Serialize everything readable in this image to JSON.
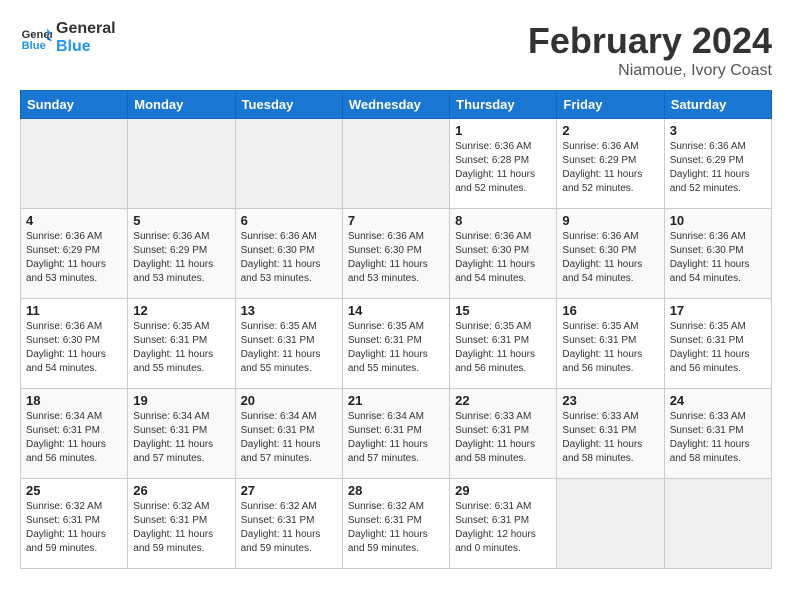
{
  "header": {
    "logo_line1": "General",
    "logo_line2": "Blue",
    "month": "February 2024",
    "location": "Niamoue, Ivory Coast"
  },
  "weekdays": [
    "Sunday",
    "Monday",
    "Tuesday",
    "Wednesday",
    "Thursday",
    "Friday",
    "Saturday"
  ],
  "weeks": [
    [
      {
        "day": "",
        "info": ""
      },
      {
        "day": "",
        "info": ""
      },
      {
        "day": "",
        "info": ""
      },
      {
        "day": "",
        "info": ""
      },
      {
        "day": "1",
        "info": "Sunrise: 6:36 AM\nSunset: 6:28 PM\nDaylight: 11 hours\nand 52 minutes."
      },
      {
        "day": "2",
        "info": "Sunrise: 6:36 AM\nSunset: 6:29 PM\nDaylight: 11 hours\nand 52 minutes."
      },
      {
        "day": "3",
        "info": "Sunrise: 6:36 AM\nSunset: 6:29 PM\nDaylight: 11 hours\nand 52 minutes."
      }
    ],
    [
      {
        "day": "4",
        "info": "Sunrise: 6:36 AM\nSunset: 6:29 PM\nDaylight: 11 hours\nand 53 minutes."
      },
      {
        "day": "5",
        "info": "Sunrise: 6:36 AM\nSunset: 6:29 PM\nDaylight: 11 hours\nand 53 minutes."
      },
      {
        "day": "6",
        "info": "Sunrise: 6:36 AM\nSunset: 6:30 PM\nDaylight: 11 hours\nand 53 minutes."
      },
      {
        "day": "7",
        "info": "Sunrise: 6:36 AM\nSunset: 6:30 PM\nDaylight: 11 hours\nand 53 minutes."
      },
      {
        "day": "8",
        "info": "Sunrise: 6:36 AM\nSunset: 6:30 PM\nDaylight: 11 hours\nand 54 minutes."
      },
      {
        "day": "9",
        "info": "Sunrise: 6:36 AM\nSunset: 6:30 PM\nDaylight: 11 hours\nand 54 minutes."
      },
      {
        "day": "10",
        "info": "Sunrise: 6:36 AM\nSunset: 6:30 PM\nDaylight: 11 hours\nand 54 minutes."
      }
    ],
    [
      {
        "day": "11",
        "info": "Sunrise: 6:36 AM\nSunset: 6:30 PM\nDaylight: 11 hours\nand 54 minutes."
      },
      {
        "day": "12",
        "info": "Sunrise: 6:35 AM\nSunset: 6:31 PM\nDaylight: 11 hours\nand 55 minutes."
      },
      {
        "day": "13",
        "info": "Sunrise: 6:35 AM\nSunset: 6:31 PM\nDaylight: 11 hours\nand 55 minutes."
      },
      {
        "day": "14",
        "info": "Sunrise: 6:35 AM\nSunset: 6:31 PM\nDaylight: 11 hours\nand 55 minutes."
      },
      {
        "day": "15",
        "info": "Sunrise: 6:35 AM\nSunset: 6:31 PM\nDaylight: 11 hours\nand 56 minutes."
      },
      {
        "day": "16",
        "info": "Sunrise: 6:35 AM\nSunset: 6:31 PM\nDaylight: 11 hours\nand 56 minutes."
      },
      {
        "day": "17",
        "info": "Sunrise: 6:35 AM\nSunset: 6:31 PM\nDaylight: 11 hours\nand 56 minutes."
      }
    ],
    [
      {
        "day": "18",
        "info": "Sunrise: 6:34 AM\nSunset: 6:31 PM\nDaylight: 11 hours\nand 56 minutes."
      },
      {
        "day": "19",
        "info": "Sunrise: 6:34 AM\nSunset: 6:31 PM\nDaylight: 11 hours\nand 57 minutes."
      },
      {
        "day": "20",
        "info": "Sunrise: 6:34 AM\nSunset: 6:31 PM\nDaylight: 11 hours\nand 57 minutes."
      },
      {
        "day": "21",
        "info": "Sunrise: 6:34 AM\nSunset: 6:31 PM\nDaylight: 11 hours\nand 57 minutes."
      },
      {
        "day": "22",
        "info": "Sunrise: 6:33 AM\nSunset: 6:31 PM\nDaylight: 11 hours\nand 58 minutes."
      },
      {
        "day": "23",
        "info": "Sunrise: 6:33 AM\nSunset: 6:31 PM\nDaylight: 11 hours\nand 58 minutes."
      },
      {
        "day": "24",
        "info": "Sunrise: 6:33 AM\nSunset: 6:31 PM\nDaylight: 11 hours\nand 58 minutes."
      }
    ],
    [
      {
        "day": "25",
        "info": "Sunrise: 6:32 AM\nSunset: 6:31 PM\nDaylight: 11 hours\nand 59 minutes."
      },
      {
        "day": "26",
        "info": "Sunrise: 6:32 AM\nSunset: 6:31 PM\nDaylight: 11 hours\nand 59 minutes."
      },
      {
        "day": "27",
        "info": "Sunrise: 6:32 AM\nSunset: 6:31 PM\nDaylight: 11 hours\nand 59 minutes."
      },
      {
        "day": "28",
        "info": "Sunrise: 6:32 AM\nSunset: 6:31 PM\nDaylight: 11 hours\nand 59 minutes."
      },
      {
        "day": "29",
        "info": "Sunrise: 6:31 AM\nSunset: 6:31 PM\nDaylight: 12 hours\nand 0 minutes."
      },
      {
        "day": "",
        "info": ""
      },
      {
        "day": "",
        "info": ""
      }
    ]
  ]
}
